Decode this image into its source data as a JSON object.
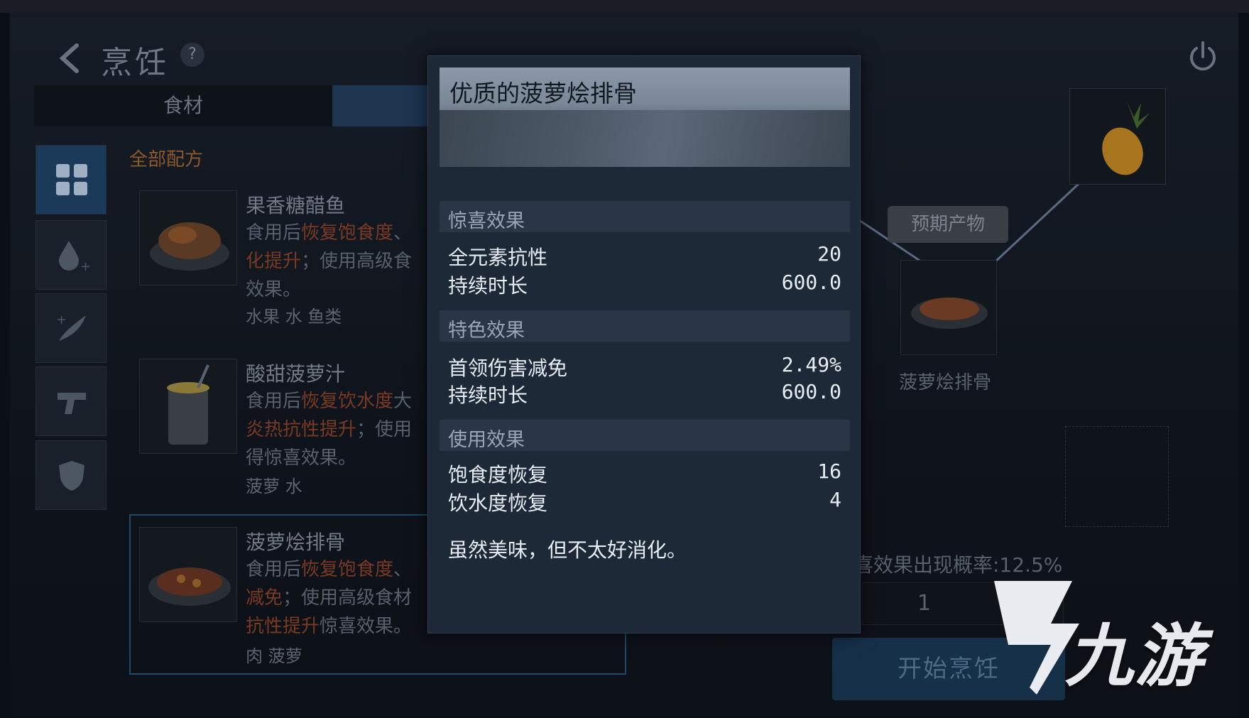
{
  "header": {
    "title": "烹饪",
    "help": "?"
  },
  "tabs": {
    "ingredients": "食材",
    "recipes": ""
  },
  "filter": {
    "label": "全部配方"
  },
  "recipes": [
    {
      "name": "果香糖醋鱼",
      "desc_parts": [
        "食用后",
        "恢复饱食度",
        "、",
        "化提升",
        "；使用高级食",
        "效果。"
      ],
      "ingredients": "水果 水 鱼类"
    },
    {
      "name": "酸甜菠萝汁",
      "desc_parts": [
        "食用后",
        "恢复饮水度",
        "大",
        "炎热抗性提升",
        "；使用",
        "得惊喜效果。"
      ],
      "ingredients": "菠萝 水"
    },
    {
      "name": "菠萝烩排骨",
      "desc_parts": [
        "食用后",
        "恢复饱食度",
        "、",
        "减免",
        "；使用高级食材",
        "抗性提升",
        "惊喜效果。"
      ],
      "ingredients": "肉 菠萝"
    }
  ],
  "right_panel": {
    "expected_label": "预期产物",
    "result_name": "菠萝烩排骨",
    "surprise_rate": "喜效果出现概率:12.5%",
    "quantity": "1",
    "start_button": "开始烹饪"
  },
  "popup": {
    "title": "优质的菠萝烩排骨",
    "sections": [
      {
        "label": "惊喜效果",
        "rows": [
          {
            "k": "全元素抗性",
            "v": "20"
          },
          {
            "k": "持续时长",
            "v": "600.0"
          }
        ]
      },
      {
        "label": "特色效果",
        "rows": [
          {
            "k": "首领伤害减免",
            "v": "2.49%"
          },
          {
            "k": "持续时长",
            "v": "600.0"
          }
        ]
      },
      {
        "label": "使用效果",
        "rows": [
          {
            "k": "饱食度恢复",
            "v": "16"
          },
          {
            "k": "饮水度恢复",
            "v": "4"
          }
        ]
      }
    ],
    "flavor_text": "虽然美味，但不太好消化。"
  },
  "watermark": {
    "text": "九游"
  },
  "icons": {
    "back": "back-arrow-icon",
    "help": "help-icon",
    "power": "power-icon",
    "categories": [
      "grid-icon",
      "water-drop-icon",
      "herb-icon",
      "gun-icon",
      "shield-icon"
    ]
  },
  "colors": {
    "accent_orange": "#8a5a2c",
    "highlight_red": "#7a3a22",
    "popup_bg": "#1e2938",
    "tab_active": "#1e3550"
  }
}
